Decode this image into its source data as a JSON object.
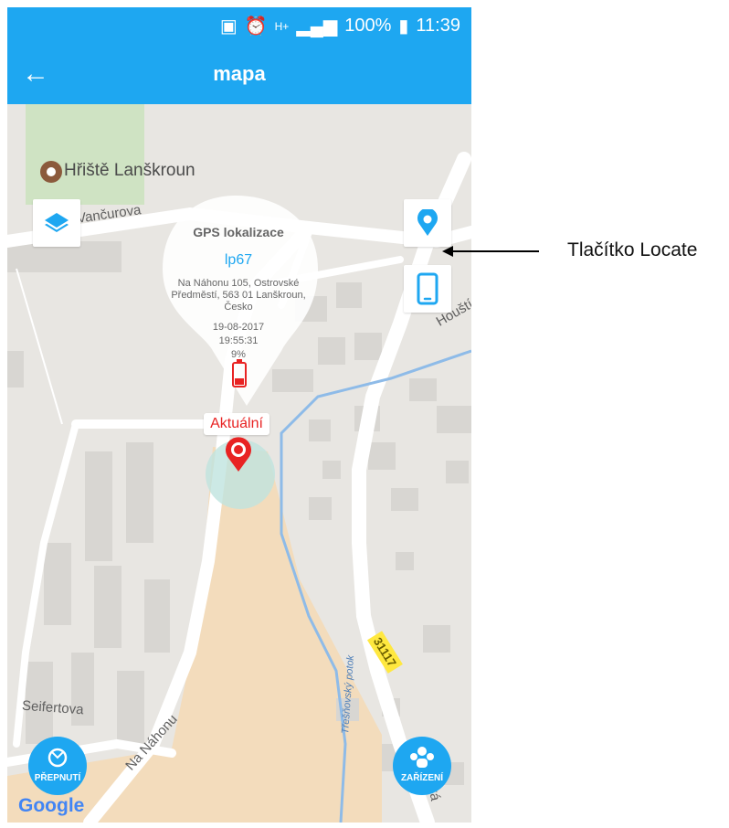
{
  "status_bar": {
    "battery": "100%",
    "time": "11:39",
    "icons": [
      "cast-icon",
      "alarm-icon",
      "network-hplus-icon",
      "signal-icon",
      "battery-icon"
    ]
  },
  "app_bar": {
    "back_icon": "arrow-left-icon",
    "title": "mapa"
  },
  "map": {
    "poi": "Hřiště Lanškroun",
    "streets": [
      "Vančurova",
      "Seifertova",
      "Na Náhonu",
      "Třešňovský potok",
      "Houští",
      "ecká"
    ],
    "road_number": "31117",
    "current_label": "Aktuální"
  },
  "popup": {
    "title": "GPS lokalizace",
    "device": "lp67",
    "address": "Na Náhonu 105, Ostrovské Předměstí, 563 01 Lanškroun, Česko",
    "date": "19-08-2017",
    "time": "19:55:31",
    "battery": "9%"
  },
  "buttons": {
    "layers_icon": "layers-icon",
    "locate_icon": "location-pin-icon",
    "phone_icon": "phone-icon",
    "switch_label": "PŘEPNUTÍ",
    "devices_label": "ZAŘÍZENÍ"
  },
  "attribution": "Google",
  "annotation": {
    "label": "Tlačítko Locate"
  },
  "colors": {
    "primary": "#1ea7f1",
    "marker": "#e82323",
    "map_bg": "#e8e6e2",
    "park": "#cfe3c3",
    "highlight_area": "#f3dcbc"
  }
}
